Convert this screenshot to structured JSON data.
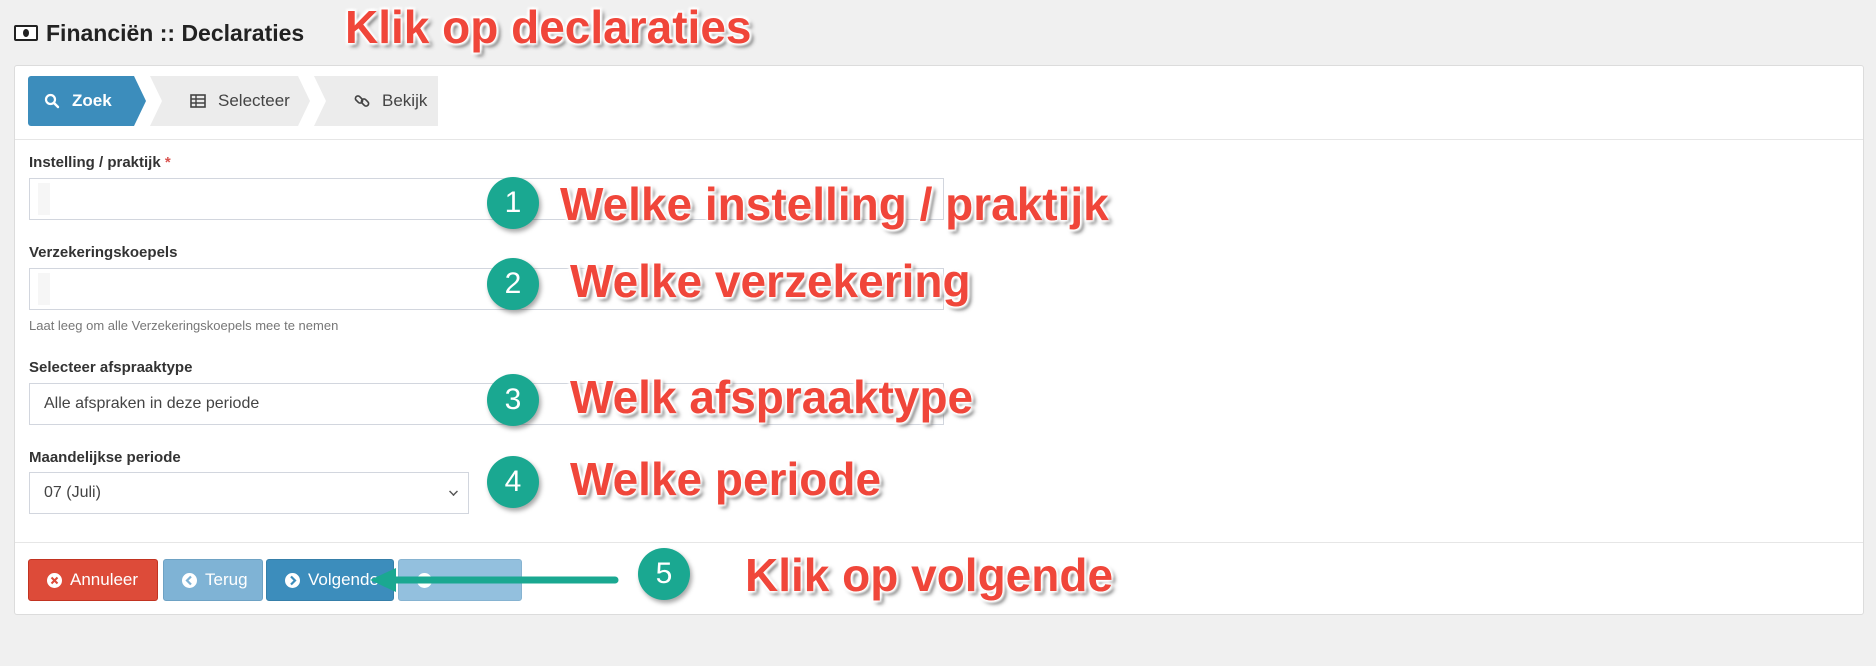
{
  "header": {
    "title": "Financiën :: Declaraties",
    "icon": "money-icon"
  },
  "wizard": {
    "steps": [
      {
        "label": "Zoek",
        "icon": "search-icon",
        "active": true
      },
      {
        "label": "Selecteer",
        "icon": "table-icon",
        "active": false
      },
      {
        "label": "Bekijk",
        "icon": "link-icon",
        "active": false
      }
    ]
  },
  "form": {
    "instelling": {
      "label": "Instelling / praktijk",
      "required_mark": "*",
      "value": ""
    },
    "koepels": {
      "label": "Verzekeringskoepels",
      "value": "",
      "help": "Laat leeg om alle Verzekeringskoepels mee te nemen"
    },
    "afspraaktype": {
      "label": "Selecteer afspraaktype",
      "value": "Alle afspraken in deze periode"
    },
    "periode": {
      "label": "Maandelijkse periode",
      "value": "07 (Juli)"
    }
  },
  "buttons": {
    "annuleer": "Annuleer",
    "terug": "Terug",
    "volgende": "Volgende"
  },
  "annotations": {
    "top": "Klik op declaraties",
    "a1": "Welke instelling / praktijk",
    "a2": "Welke verzekering",
    "a3": "Welk afspraaktype",
    "a4": "Welke periode",
    "a5": "Klik op volgende",
    "n1": "1",
    "n2": "2",
    "n3": "3",
    "n4": "4",
    "n5": "5"
  },
  "colors": {
    "primary": "#3c8dbc",
    "danger": "#dd4b39",
    "annotation_text": "#f0463a",
    "badge": "#1aa891"
  }
}
